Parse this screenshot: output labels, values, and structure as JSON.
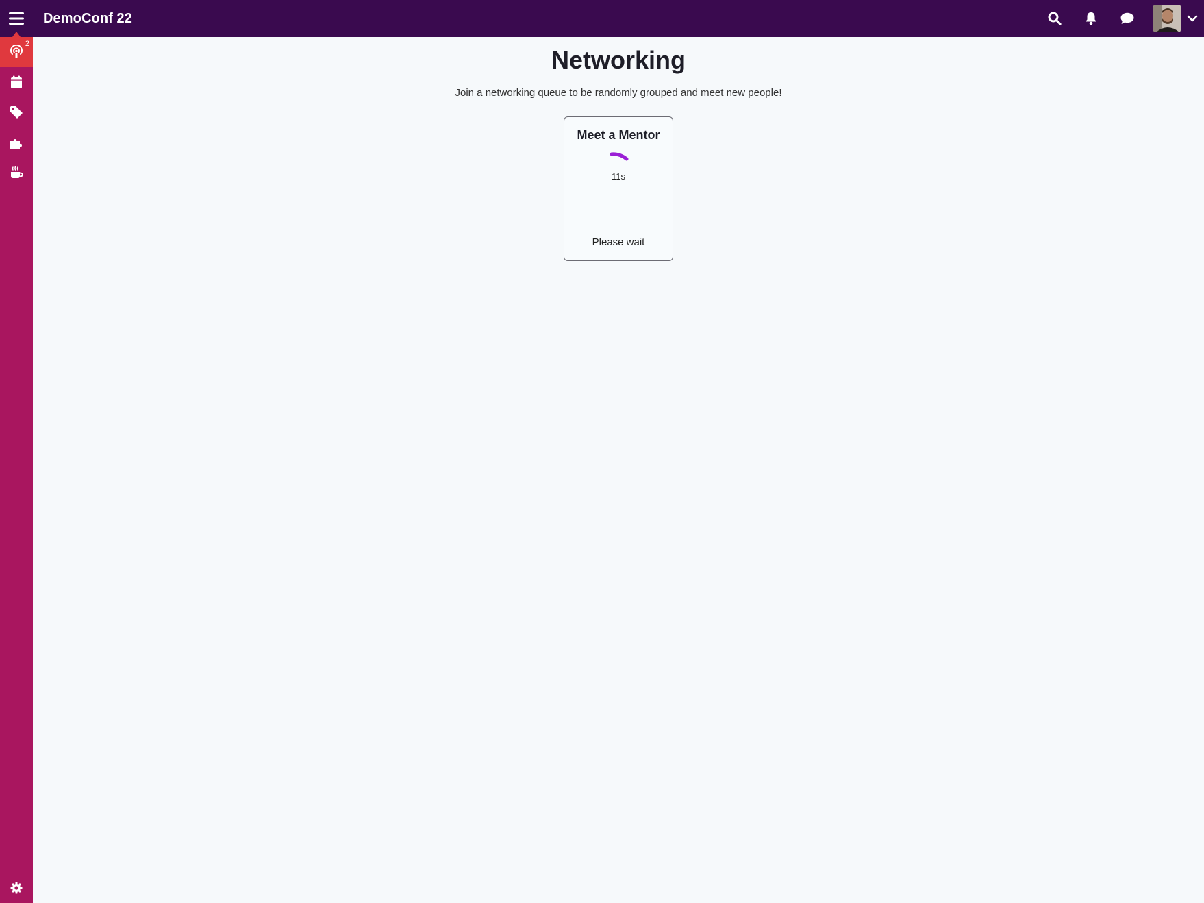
{
  "header": {
    "app_title": "DemoConf 22",
    "icons": [
      "menu-icon",
      "search-icon",
      "bell-icon",
      "chat-icon",
      "avatar",
      "chevron-down-icon"
    ]
  },
  "sidebar": {
    "items": [
      {
        "icon": "podcast-icon",
        "badge": "2",
        "active": true
      },
      {
        "icon": "calendar-icon"
      },
      {
        "icon": "tag-icon"
      },
      {
        "icon": "puzzle-icon"
      },
      {
        "icon": "coffee-icon"
      }
    ],
    "footer_icon": "gear-icon"
  },
  "page": {
    "title": "Networking",
    "subtitle": "Join a networking queue to be randomly grouped and meet new people!"
  },
  "queue_card": {
    "title": "Meet a Mentor",
    "timer": "11s",
    "status": "Please wait"
  },
  "colors": {
    "topbar": "#3a0a4f",
    "sidebar": "#a9165f",
    "sidebar_active": "#e0393e",
    "spinner": "#9b1fd6",
    "background": "#f6f9fb"
  }
}
